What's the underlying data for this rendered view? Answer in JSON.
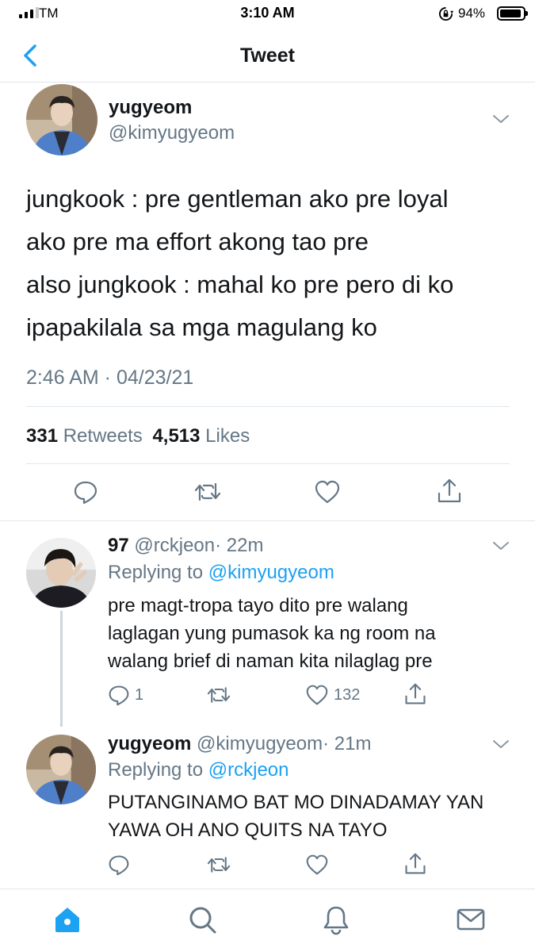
{
  "status_bar": {
    "carrier": "TM",
    "time": "3:10 AM",
    "battery_percent_label": "94%",
    "battery_level": 0.94,
    "signal_bars": 3
  },
  "nav": {
    "title": "Tweet",
    "back_icon": "chevron-left-icon"
  },
  "main_tweet": {
    "display_name": "yugyeom",
    "handle": "@kimyugyeom",
    "text_lines": [
      "jungkook : pre gentleman ako pre loyal",
      "ako pre ma effort akong tao pre",
      "also jungkook : mahal ko pre pero di ko",
      "ipapakilala sa mga magulang ko"
    ],
    "timestamp": "2:46 AM · 04/23/21",
    "retweets_count": "331",
    "retweets_label": "Retweets",
    "likes_count": "4,513",
    "likes_label": "Likes"
  },
  "replies": [
    {
      "display_name": "97",
      "handle": "@rckjeon",
      "time": "· 22m",
      "replying_to_label": "Replying to",
      "replying_to_handle": "@kimyugyeom",
      "text_lines": [
        "pre magt-tropa tayo dito pre walang",
        "laglagan yung pumasok ka ng room na",
        "walang brief di naman kita nilaglag pre"
      ],
      "reply_count": "1",
      "like_count": "132"
    },
    {
      "display_name": "yugyeom",
      "handle": "@kimyugyeom",
      "time": "· 21m",
      "replying_to_label": "Replying to",
      "replying_to_handle": "@rckjeon",
      "text_lines": [
        "PUTANGINAMO BAT MO DINADAMAY YAN",
        "YAWA OH ANO QUITS NA TAYO"
      ]
    }
  ],
  "tab_bar": {
    "icons": [
      "home-icon",
      "search-icon",
      "notifications-icon",
      "messages-icon"
    ],
    "active_color": "#1da1f2"
  },
  "colors": {
    "accent": "#1da1f2",
    "secondary_text": "#657786",
    "primary_text": "#14171a",
    "divider": "#e1e8ed"
  }
}
